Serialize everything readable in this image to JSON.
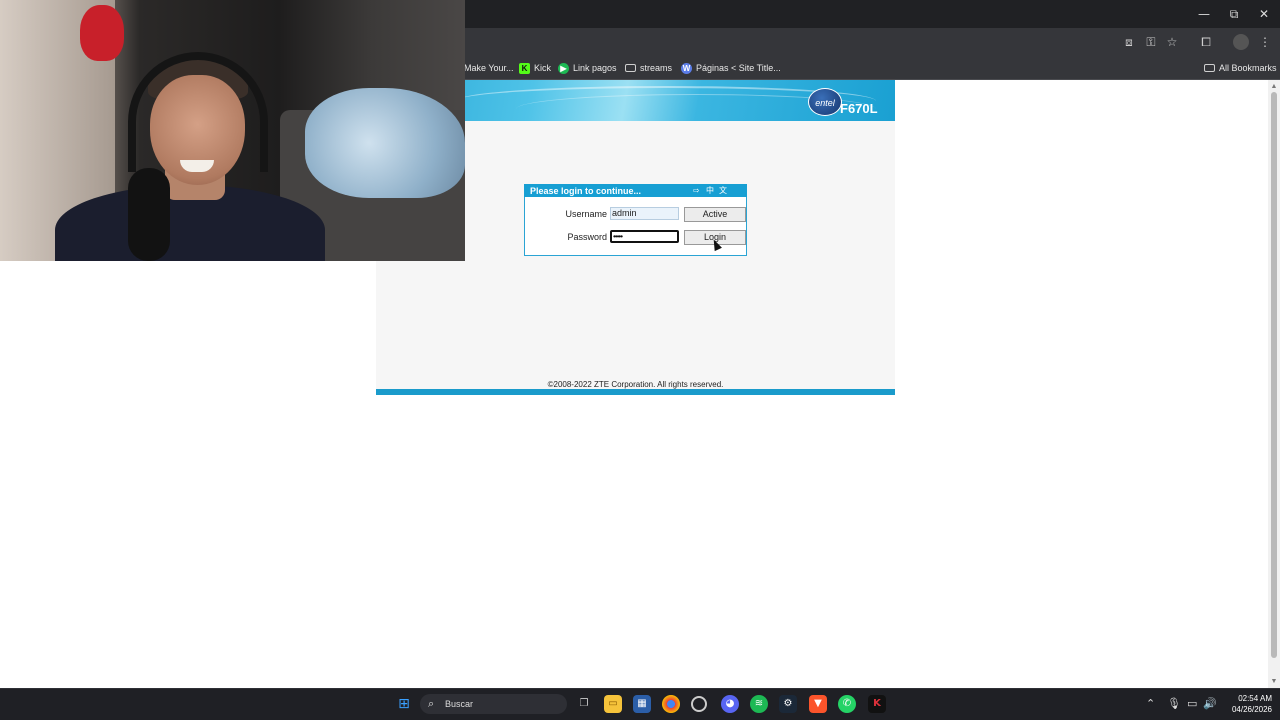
{
  "browser": {
    "window_controls": {
      "minimize": "—",
      "restore": "⧉",
      "close": "✕"
    },
    "toolbar_icons": [
      "translate-icon",
      "password-key-icon",
      "bookmark-star-icon",
      "extensions-icon",
      "profile-icon",
      "menu-icon"
    ],
    "bookmarks": [
      {
        "label": "Make Your...",
        "icon": "page-icon",
        "color": "#888888"
      },
      {
        "label": "Kick",
        "icon": "kick-icon",
        "color": "#53fc18"
      },
      {
        "label": "Link pagos",
        "icon": "play-circle-icon",
        "color": "#1db954"
      },
      {
        "label": "streams",
        "icon": "folder-icon",
        "color": "#cfcfcf"
      },
      {
        "label": "Páginas < Site Title...",
        "icon": "wordpress-icon",
        "color": "#5b7de8"
      }
    ],
    "all_bookmarks_label": "All Bookmarks"
  },
  "router": {
    "brand": "entel",
    "model": "F670L",
    "login": {
      "title": "Please login to continue...",
      "lang_icons": [
        "⇨",
        "中",
        "文"
      ],
      "username_label": "Username",
      "username_value": "admin",
      "password_label": "Password",
      "password_value": "•••••",
      "active_button": "Active",
      "login_button": "Login"
    },
    "footer": "©2008-2022 ZTE Corporation. All rights reserved.",
    "colors": {
      "header": "#179fd3",
      "footer_bar": "#1a9bcb"
    }
  },
  "taskbar": {
    "search_placeholder": "Buscar",
    "apps": [
      "windows-start-icon",
      "task-view-icon",
      "file-explorer-icon",
      "store-icon",
      "chrome-icon",
      "obs-icon",
      "discord-icon",
      "spotify-icon",
      "steam-icon",
      "brave-icon",
      "whatsapp-icon",
      "kick-app-icon"
    ],
    "time": "02:54 AM",
    "date": "04/26/2026"
  }
}
